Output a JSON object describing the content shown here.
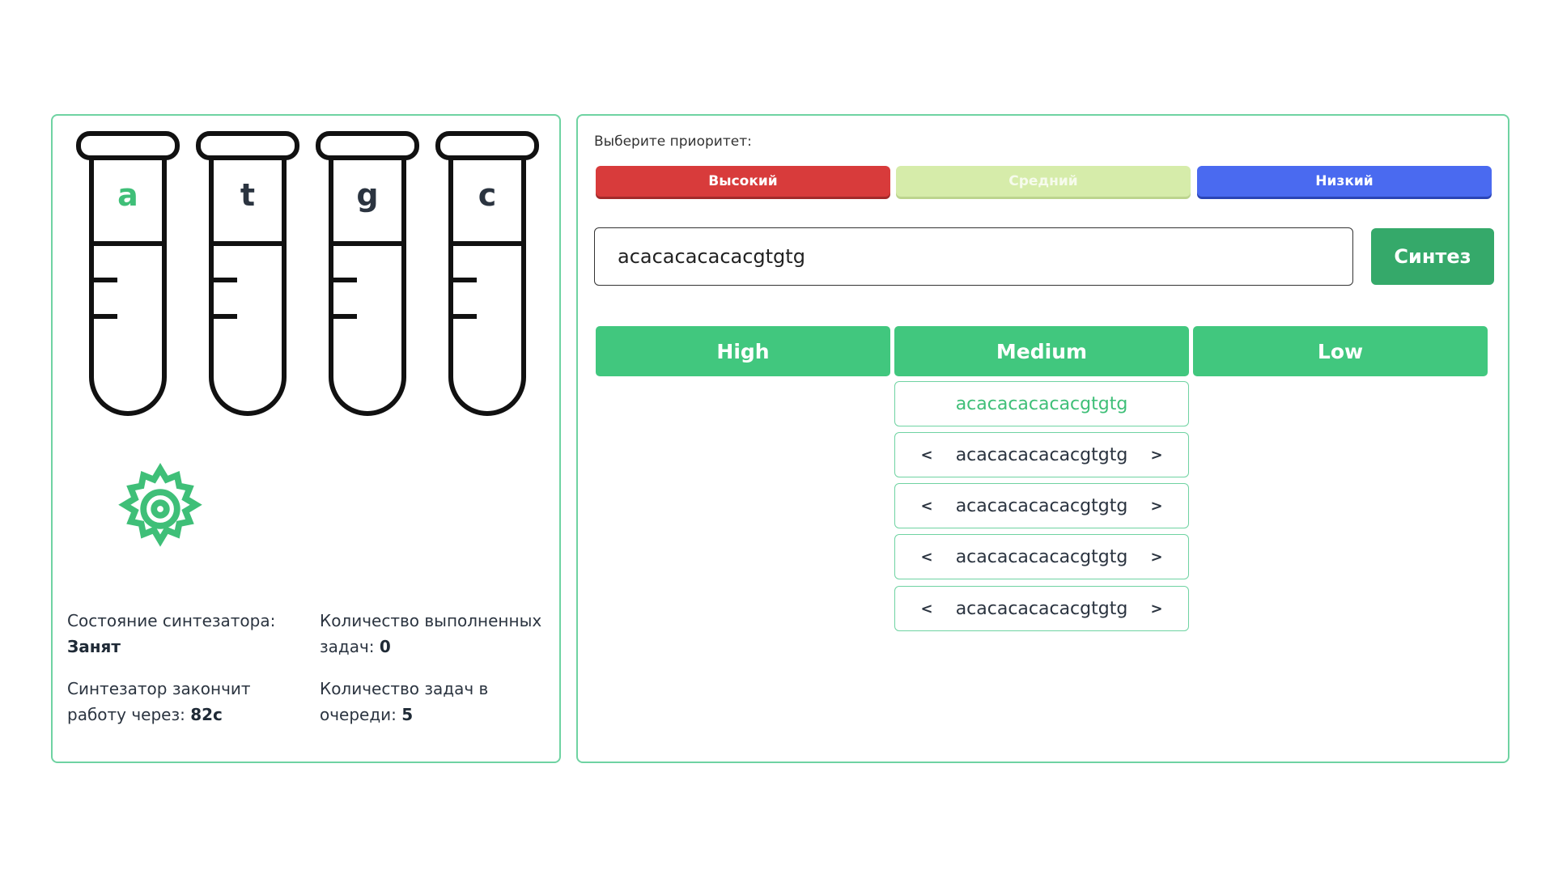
{
  "tubes": [
    {
      "letter": "a",
      "active": true
    },
    {
      "letter": "t",
      "active": false
    },
    {
      "letter": "g",
      "active": false
    },
    {
      "letter": "c",
      "active": false
    }
  ],
  "stats": {
    "status_label": "Состояние синтезатора:",
    "status_value": "Занят",
    "done_label": "Количество выполненных задач:",
    "done_value": "0",
    "remaining_label": "Синтезатор закончит работу через:",
    "remaining_value": "82с",
    "queue_label": "Количество задач в очереди:",
    "queue_value": "5"
  },
  "priority": {
    "label": "Выберите приоритет:",
    "high": "Высокий",
    "medium": "Средний",
    "low": "Низкий",
    "selected": "medium",
    "colors": {
      "high": "#d83b3b",
      "medium": "#d6ecaa",
      "low": "#4a6af0"
    }
  },
  "sequence_input": {
    "value": "acacacacacacgtgtg"
  },
  "synth_button": "Синтез",
  "queue": {
    "headers": {
      "high": "High",
      "medium": "Medium",
      "low": "Low"
    },
    "medium_items": [
      {
        "text": "acacacacacacgtgtg",
        "current": true
      },
      {
        "text": "acacacacacacgtgtg",
        "current": false
      },
      {
        "text": "acacacacacacgtgtg",
        "current": false
      },
      {
        "text": "acacacacacacgtgtg",
        "current": false
      },
      {
        "text": "acacacacacacgtgtg",
        "current": false
      }
    ],
    "arrow_left": "<",
    "arrow_right": ">"
  },
  "accent_color": "#41c77e"
}
